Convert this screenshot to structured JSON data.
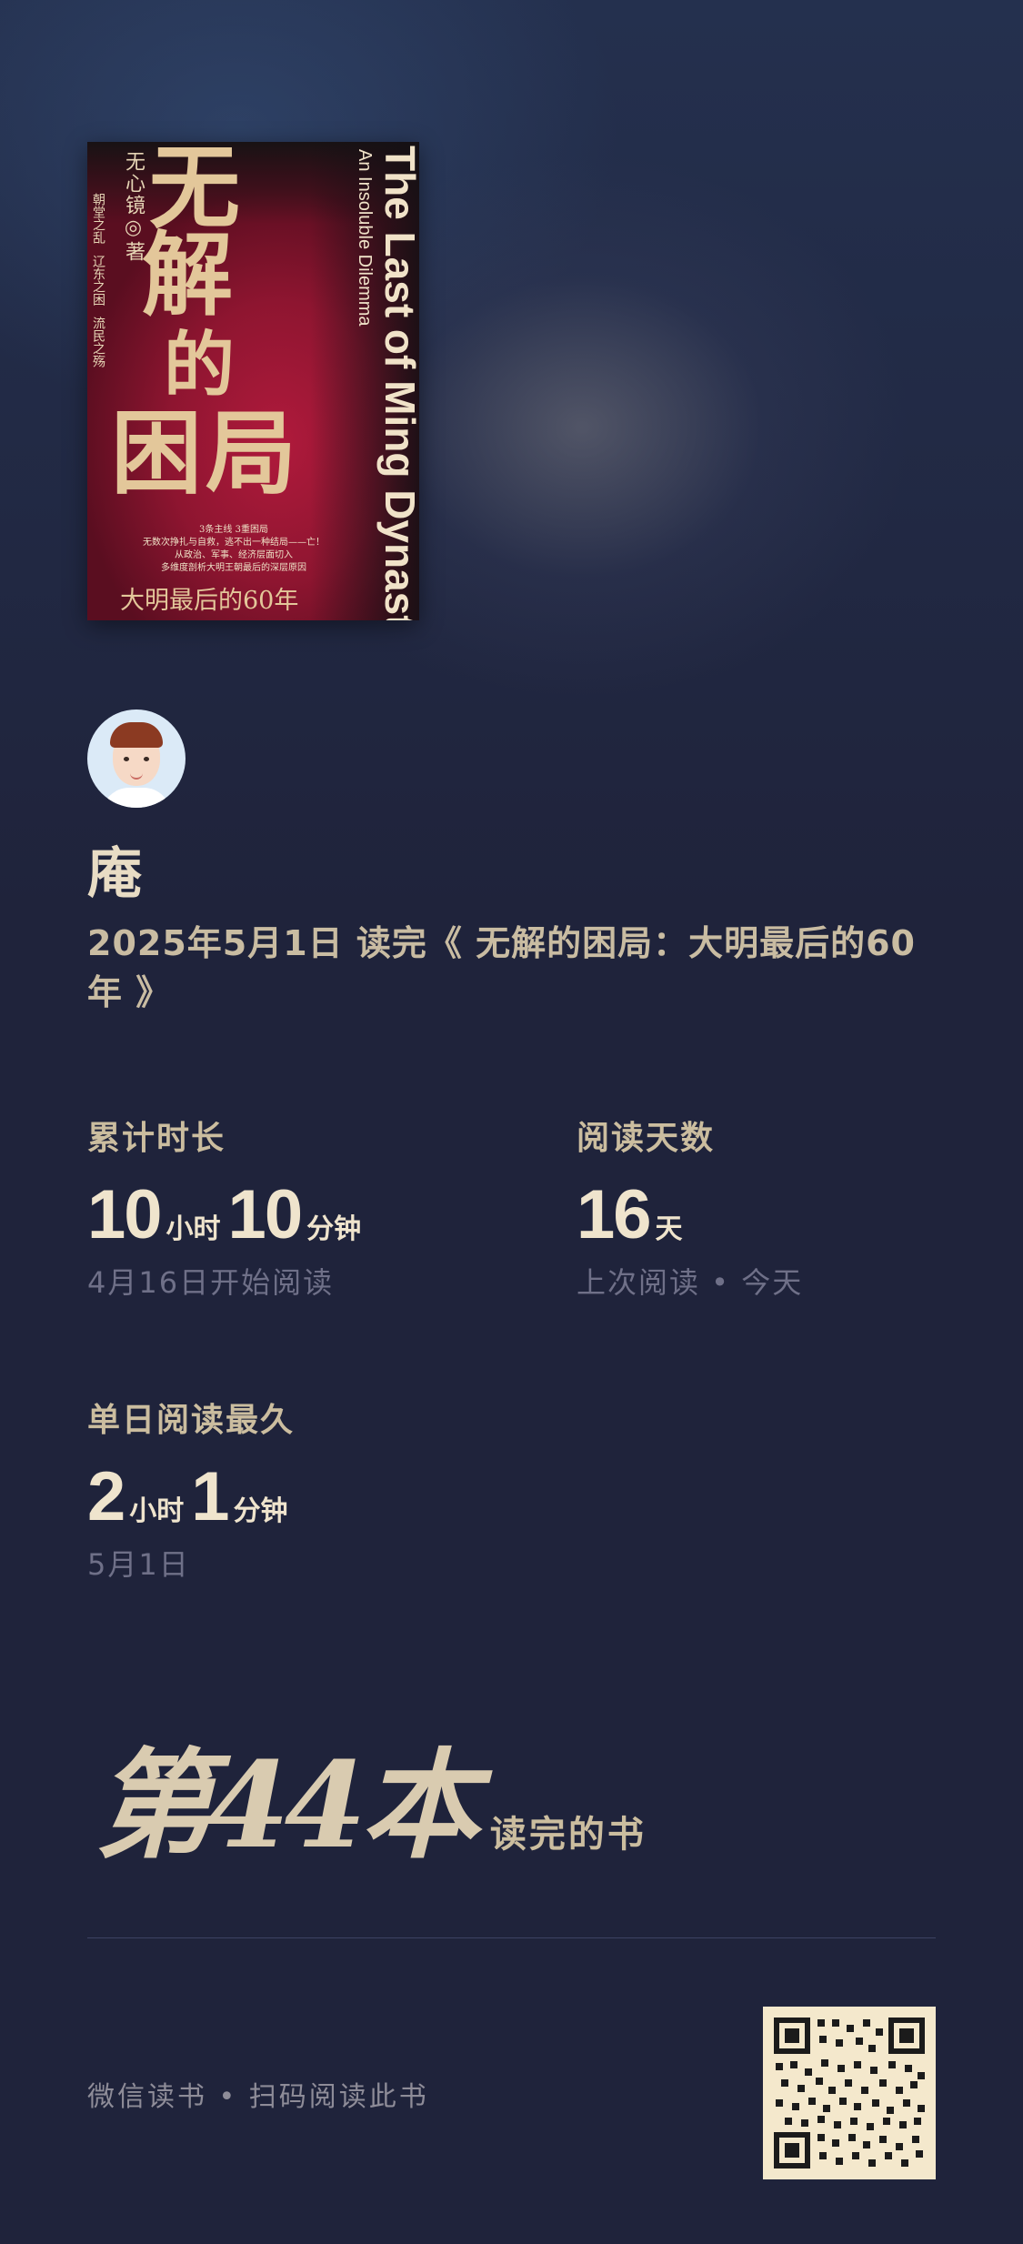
{
  "book": {
    "cover": {
      "author": "无心镜◎著",
      "tags": [
        "朝堂之乱",
        "辽东之困",
        "流民之殇"
      ],
      "title_chars": [
        "无",
        "解",
        "的",
        "困",
        "局"
      ],
      "english_line1": "An Insoluble Dilemma",
      "english_line2": "The Last of Ming Dynasty",
      "blurb": [
        "3条主线 3重困局",
        "无数次挣扎与自救，逃不出一种结局——亡！",
        "从政治、军事、经济层面切入",
        "多维度剖析大明王朝最后的深层原因"
      ],
      "subtitle": "大明最后的60年"
    }
  },
  "user": {
    "name": "庵",
    "finish_text": "2025年5月1日 读完《 无解的困局：大明最后的60年 》"
  },
  "stats": {
    "total_time": {
      "label": "累计时长",
      "hours": "10",
      "hours_unit": "小时",
      "minutes": "10",
      "minutes_unit": "分钟",
      "note": "4月16日开始阅读"
    },
    "reading_days": {
      "label": "阅读天数",
      "days": "16",
      "days_unit": "天",
      "note": "上次阅读 • 今天"
    },
    "longest_day": {
      "label": "单日阅读最久",
      "hours": "2",
      "hours_unit": "小时",
      "minutes": "1",
      "minutes_unit": "分钟",
      "note": "5月1日"
    }
  },
  "rank": {
    "main": "第44本",
    "sub": "读完的书"
  },
  "footer": {
    "text": "微信读书 • 扫码阅读此书"
  },
  "colors": {
    "background": "#1f233b",
    "accent_gold": "#d8c7a6",
    "cover_red": "#8e1530"
  }
}
